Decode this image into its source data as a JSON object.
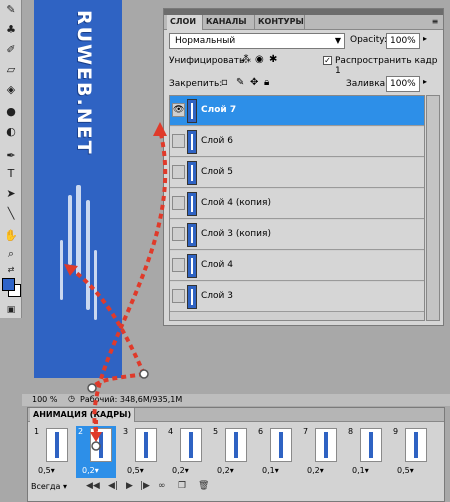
{
  "toolbox": {
    "tools": [
      "brush-icon",
      "stamp-icon",
      "history-brush-icon",
      "eraser-icon",
      "bucket-icon",
      "blur-icon",
      "dodge-icon",
      "pen-icon",
      "type-icon",
      "path-select-icon",
      "line-icon",
      "hand-icon",
      "zoom-icon"
    ],
    "foreground_color": "#2d63c8",
    "background_color": "#ffffff"
  },
  "canvas": {
    "logo_text": "RUWEB.NET",
    "image_color": "#2f63c3"
  },
  "layers_panel": {
    "tabs": [
      "СЛОИ",
      "КАНАЛЫ",
      "КОНТУРЫ"
    ],
    "blend_mode": "Нормальный",
    "opacity_label": "Opacity:",
    "opacity_value": "100%",
    "unify_label": "Унифицировать:",
    "propagate_label": "Распространить кадр 1",
    "propagate_checked": true,
    "lock_label": "Закрепить:",
    "fill_label": "Заливка:",
    "fill_value": "100%",
    "layers": [
      {
        "name": "Слой 7",
        "visible": true,
        "selected": true
      },
      {
        "name": "Слой 6",
        "visible": false,
        "selected": false
      },
      {
        "name": "Слой 5",
        "visible": false,
        "selected": false
      },
      {
        "name": "Слой 4 (копия)",
        "visible": false,
        "selected": false
      },
      {
        "name": "Слой 3 (копия)",
        "visible": false,
        "selected": false
      },
      {
        "name": "Слой 4",
        "visible": false,
        "selected": false
      },
      {
        "name": "Слой 3",
        "visible": false,
        "selected": false
      }
    ]
  },
  "statusbar": {
    "zoom": "100 %",
    "doc_info": "Рабочий: 348,6M/935,1M"
  },
  "animation_panel": {
    "tab_label": "АНИМАЦИЯ (КАДРЫ)",
    "loop": "Всегда",
    "frames": [
      {
        "number": "1",
        "delay": "0,5▾",
        "selected": false
      },
      {
        "number": "2",
        "delay": "0,2▾",
        "selected": true
      },
      {
        "number": "3",
        "delay": "0,5▾",
        "selected": false
      },
      {
        "number": "4",
        "delay": "0,2▾",
        "selected": false
      },
      {
        "number": "5",
        "delay": "0,2▾",
        "selected": false
      },
      {
        "number": "6",
        "delay": "0,1▾",
        "selected": false
      },
      {
        "number": "7",
        "delay": "0,2▾",
        "selected": false
      },
      {
        "number": "8",
        "delay": "0,1▾",
        "selected": false
      },
      {
        "number": "9",
        "delay": "0,5▾",
        "selected": false
      }
    ]
  },
  "annotation_color": "#e03a2a"
}
